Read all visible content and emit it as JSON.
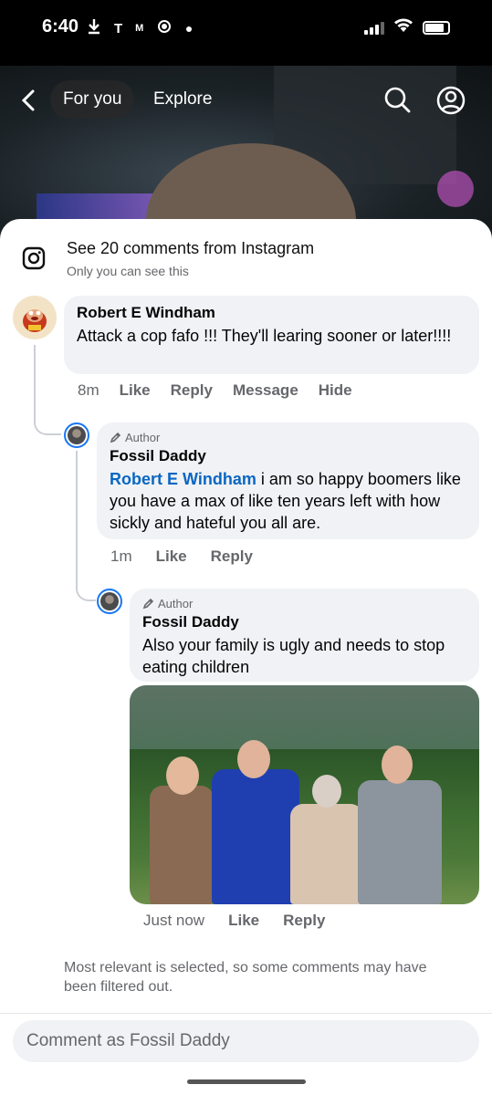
{
  "status_bar": {
    "time": "6:40",
    "indicators": [
      "download-icon",
      "T",
      "M",
      "location-icon",
      "dot"
    ]
  },
  "header": {
    "tab_active": "For you",
    "tab_other": "Explore"
  },
  "instagram_banner": {
    "title": "See 20 comments from Instagram",
    "subtitle": "Only you can see this"
  },
  "comments": [
    {
      "name": "Robert E Windham",
      "text": "Attack a cop  fafo !!! They'll learing sooner or later!!!!",
      "time": "8m",
      "actions": [
        "Like",
        "Reply",
        "Message",
        "Hide"
      ]
    },
    {
      "badge": "Author",
      "name": "Fossil Daddy",
      "mention": "Robert E Windham",
      "text": " i am so happy boomers like you have a max of like ten years left with how sickly and hateful you all are.",
      "time": "1m",
      "actions": [
        "Like",
        "Reply"
      ]
    },
    {
      "badge": "Author",
      "name": "Fossil Daddy",
      "text": "Also your family is ugly and needs to stop eating children",
      "time": "Just now",
      "actions": [
        "Like",
        "Reply"
      ]
    }
  ],
  "filter_note": "Most relevant is selected, so some comments may have been filtered out.",
  "composer": {
    "placeholder": "Comment as Fossil Daddy"
  }
}
